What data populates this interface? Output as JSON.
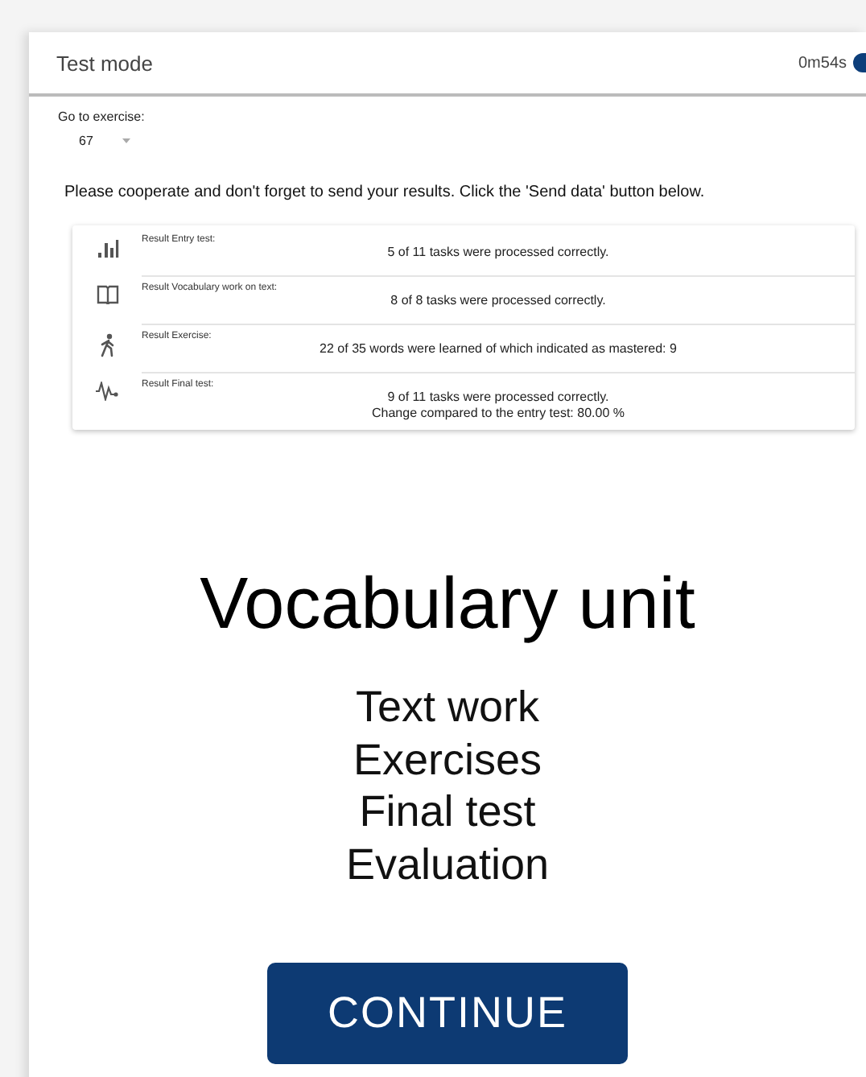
{
  "header": {
    "title": "Test mode",
    "timer": "0m54s"
  },
  "exercise_select": {
    "label": "Go to exercise:",
    "value": "67"
  },
  "notice": "Please cooperate and don't forget to send your results. Click the 'Send data' button below.",
  "results": [
    {
      "kind": "chart",
      "label": "Result Entry test:",
      "lines": [
        "5 of 11 tasks were processed correctly."
      ]
    },
    {
      "kind": "book",
      "label": "Result Vocabulary work on text:",
      "lines": [
        "8 of 8 tasks were processed correctly."
      ]
    },
    {
      "kind": "walk",
      "label": "Result Exercise:",
      "lines": [
        "22 of 35 words were learned of which indicated as mastered: 9"
      ]
    },
    {
      "kind": "pulse",
      "label": "Result Final test:",
      "lines": [
        "9 of 11 tasks were processed correctly.",
        "Change compared to the entry test: 80.00 %"
      ]
    }
  ],
  "unit": {
    "title": "Vocabulary unit",
    "items": [
      "Text work",
      "Exercises",
      "Final test",
      "Evaluation"
    ]
  },
  "continue_button": "CONTINUE"
}
